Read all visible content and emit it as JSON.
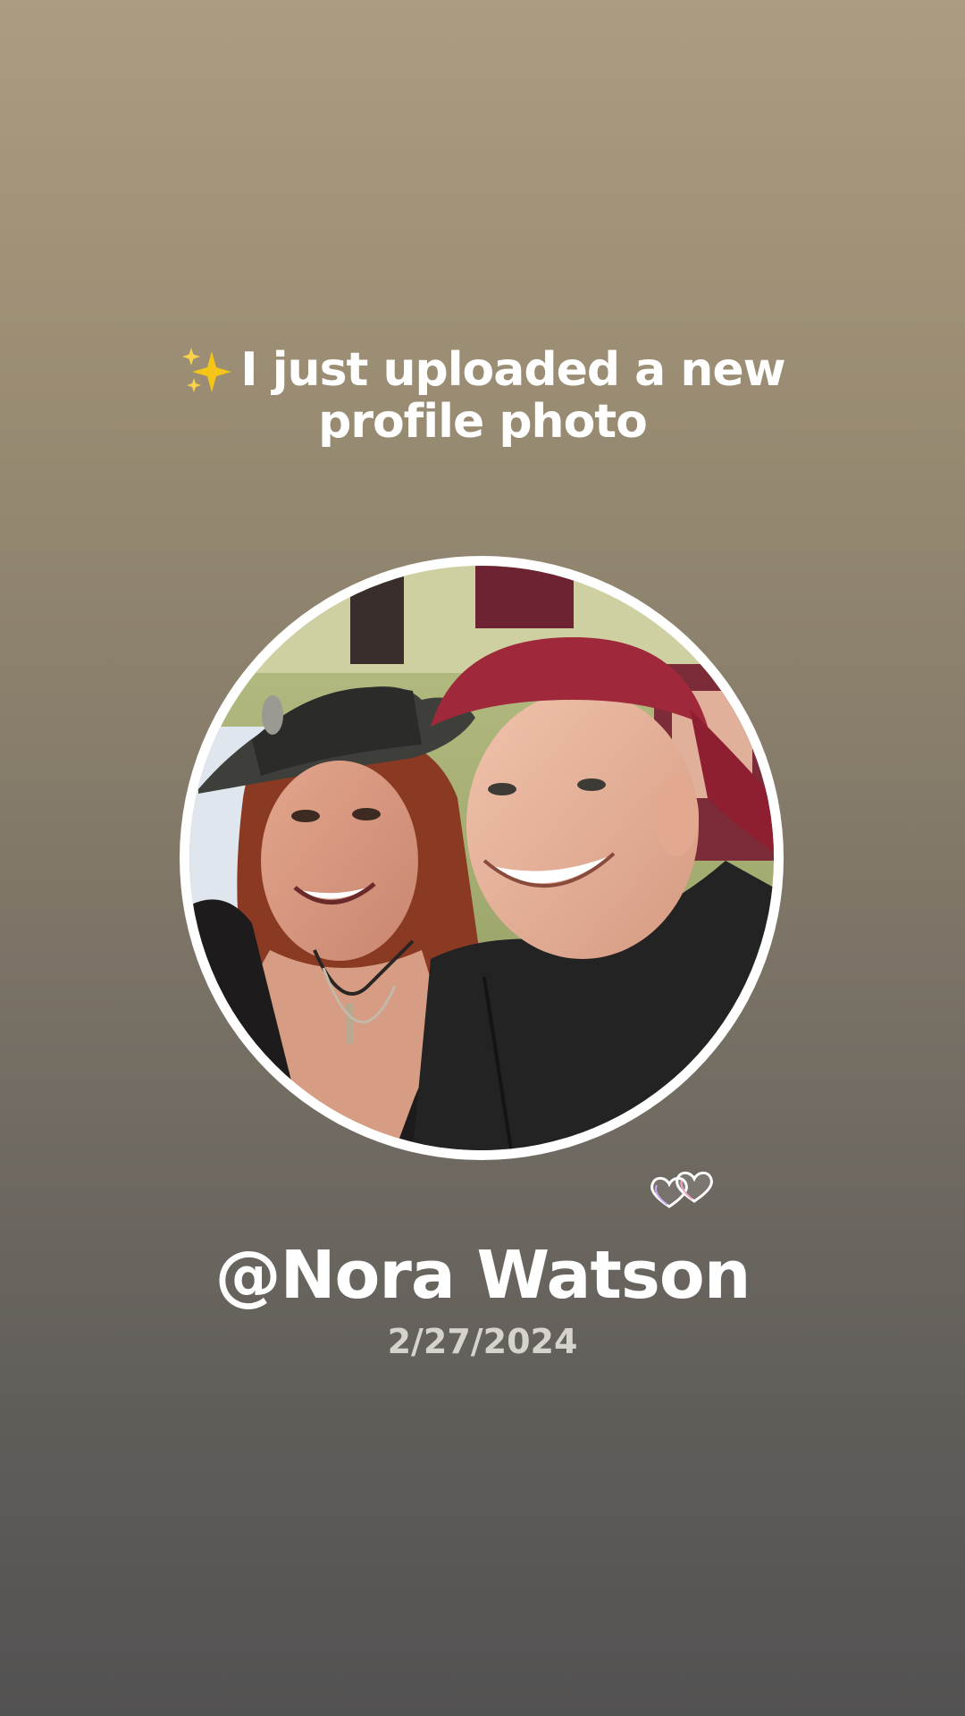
{
  "post": {
    "sparkle_icon": "sparkles-icon",
    "headline_line1": "I just uploaded a new",
    "headline_line2": "profile photo",
    "photo_icon": "profile-photo-avatar",
    "hearts_icon": "two-hearts-icon",
    "username": "@Nora Watson",
    "date": "2/27/2024"
  },
  "colors": {
    "background_top": "#ab9d7f",
    "background_bottom": "#535252",
    "text_primary": "#ffffff",
    "text_secondary": "#d6d2cc",
    "sparkle": "#f5c518"
  }
}
